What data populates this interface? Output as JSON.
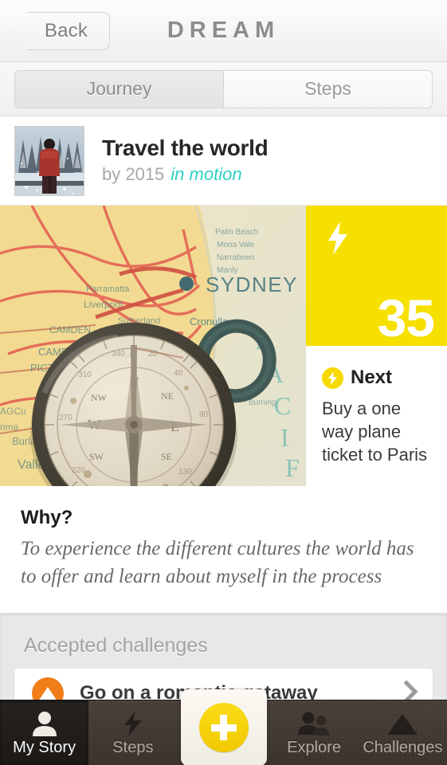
{
  "navbar": {
    "back_label": "Back",
    "title": "DREAM"
  },
  "segmented_control": {
    "tabs": [
      {
        "label": "Journey",
        "selected": true
      },
      {
        "label": "Steps",
        "selected": false
      }
    ]
  },
  "dream_header": {
    "title": "Travel the world",
    "by_label": "by 2015",
    "status": "in motion",
    "thumbnail_alt": "person-in-red-jacket-snowy-forest"
  },
  "hero": {
    "image_alt": "vintage-compass-on-sydney-map",
    "map_labels": [
      "SYDNEY",
      "Cronulla",
      "CAMPBELL",
      "PICTON",
      "Liverpool",
      "Parramatta",
      "Sutherland",
      "P A C I F I C"
    ],
    "streak": {
      "icon": "lightning-bolt-icon",
      "value": "35"
    },
    "next": {
      "badge_icon": "lightning-bolt-badge-icon",
      "label": "Next",
      "task": "Buy a one way plane ticket to Paris"
    }
  },
  "why": {
    "heading": "Why?",
    "body": "To experience the different cultures the world has to offer and learn about myself in the process"
  },
  "challenges": {
    "heading": "Accepted challenges",
    "items": [
      {
        "icon": "mountain-icon",
        "label": "Go on a romantic getaway",
        "chevron": "chevron-right-icon"
      }
    ]
  },
  "tabbar": {
    "items": [
      {
        "label": "My Story",
        "icon": "person-icon",
        "active": true
      },
      {
        "label": "Steps",
        "icon": "lightning-bolt-icon",
        "active": false
      },
      {
        "label": "Explore",
        "icon": "two-people-icon",
        "active": false
      },
      {
        "label": "Challenges",
        "icon": "mountain-icon",
        "active": false
      }
    ],
    "add_button": {
      "icon": "plus-icon"
    }
  },
  "colors": {
    "yellow": "#F6E000",
    "teal": "#2FD0C4",
    "orange": "#F07D17",
    "tabbar": "#3E3630"
  }
}
